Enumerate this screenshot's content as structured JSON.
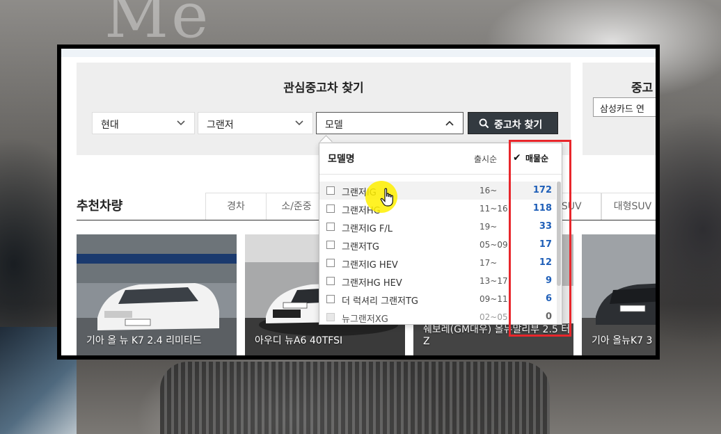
{
  "background": {
    "watermark_text": "Me"
  },
  "search": {
    "title": "관심중고차 찾기",
    "maker": "현대",
    "model_group": "그랜저",
    "model": "모델",
    "button_label": "중고차 찾기"
  },
  "side": {
    "title": "중고",
    "select_value": "삼성카드 연"
  },
  "recommend": {
    "title": "추천차량",
    "tabs": [
      "경차",
      "소/준중",
      "형SUV",
      "대형SUV"
    ]
  },
  "cards": [
    {
      "caption": "기아 올 뉴 K7 2.4 리미티드"
    },
    {
      "caption": "아우디 뉴A6 40TFSI"
    },
    {
      "caption_line1": "쉐보레(GM대우) 올뉴말리부 2.5 터",
      "caption_line2": "Z"
    },
    {
      "caption": "기아 올뉴K7 3"
    }
  ],
  "dropdown": {
    "header": {
      "name": "모델명",
      "date": "출시순",
      "count": "매물순",
      "check": "✔"
    },
    "rows": [
      {
        "name": "그랜저IG",
        "date": "16~",
        "count": "172"
      },
      {
        "name": "그랜저HG",
        "date": "11~16",
        "count": "118"
      },
      {
        "name": "그랜저IG F/L",
        "date": "19~",
        "count": "33"
      },
      {
        "name": "그랜저TG",
        "date": "05~09",
        "count": "17"
      },
      {
        "name": "그랜저IG HEV",
        "date": "17~",
        "count": "12"
      },
      {
        "name": "그랜저HG HEV",
        "date": "13~17",
        "count": "9"
      },
      {
        "name": "더 럭셔리 그랜저TG",
        "date": "09~11",
        "count": "6"
      },
      {
        "name": "뉴그랜저XG",
        "date": "02~05",
        "count": "0"
      }
    ]
  },
  "colors": {
    "highlight_box": "#e8262b",
    "count_blue": "#1f5fb8",
    "button_dark": "#333a40",
    "cursor_highlight": "#fff000"
  }
}
